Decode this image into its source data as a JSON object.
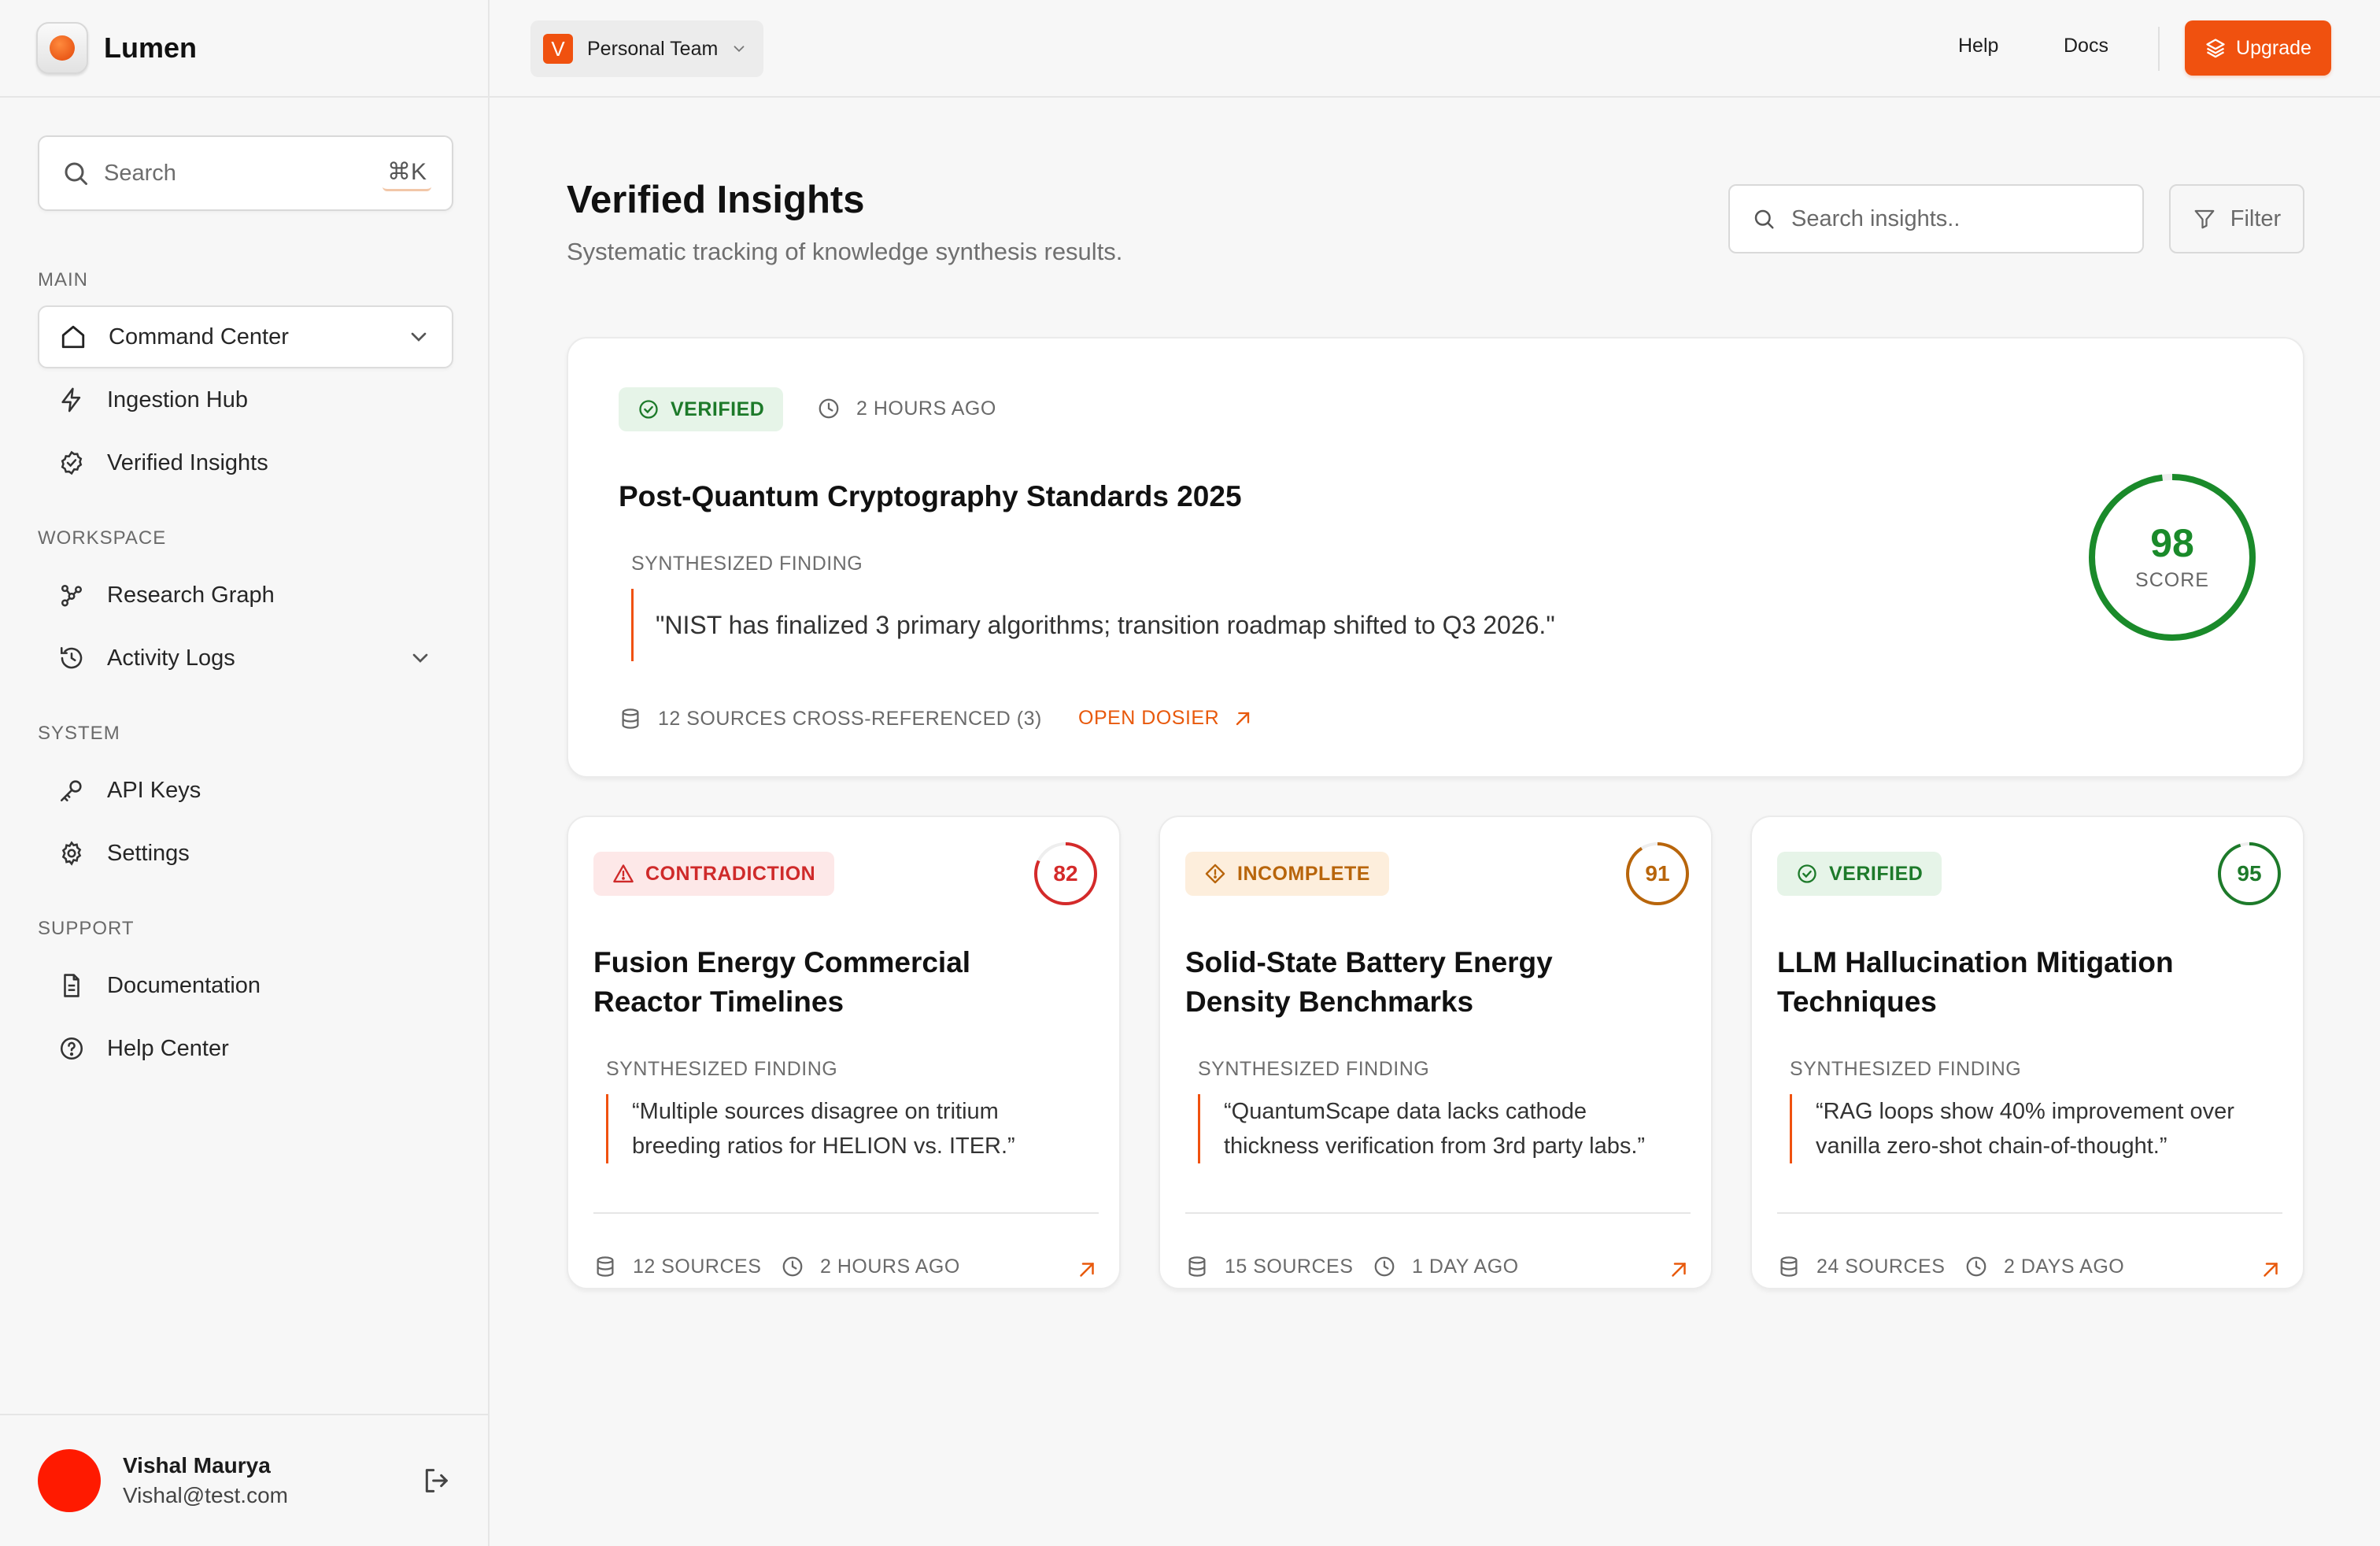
{
  "brand": {
    "name": "Lumen"
  },
  "sidebar": {
    "search": {
      "placeholder": "Search",
      "shortcut": "⌘K"
    },
    "sections": [
      {
        "title": "MAIN",
        "items": [
          {
            "label": "Command Center",
            "icon": "home-icon",
            "active": true
          },
          {
            "label": "Ingestion Hub",
            "icon": "bolt-icon"
          },
          {
            "label": "Verified Insights",
            "icon": "check-badge-icon"
          }
        ]
      },
      {
        "title": "WORKSPACE",
        "items": [
          {
            "label": "Research Graph",
            "icon": "graph-icon"
          },
          {
            "label": "Activity Logs",
            "icon": "history-icon"
          }
        ]
      },
      {
        "title": "SYSTEM",
        "items": [
          {
            "label": "API Keys",
            "icon": "key-icon"
          },
          {
            "label": "Settings",
            "icon": "gear-icon"
          }
        ]
      },
      {
        "title": "SUPPORT",
        "items": [
          {
            "label": "Documentation",
            "icon": "document-icon"
          },
          {
            "label": "Help Center",
            "icon": "help-circle-icon"
          }
        ]
      }
    ],
    "user": {
      "name": "Vishal Maurya",
      "email": "Vishal@test.com"
    }
  },
  "topbar": {
    "team": {
      "initial": "V",
      "name": "Personal Team"
    },
    "help": "Help",
    "docs": "Docs",
    "upgrade": "Upgrade"
  },
  "page": {
    "title": "Verified Insights",
    "subtitle": "Systematic tracking of knowledge synthesis results.",
    "search_placeholder": "Search insights..",
    "filter_label": "Filter"
  },
  "featured": {
    "status": "VERIFIED",
    "time": "2 HOURS AGO",
    "title": "Post-Quantum Cryptography Standards 2025",
    "finding_label": "SYNTHESIZED FINDING",
    "finding": "\"NIST has finalized 3 primary algorithms; transition roadmap shifted to Q3 2026.\"",
    "sources": "12 SOURCES CROSS-REFERENCED (3)",
    "open_label": "OPEN DOSIER",
    "score": 98,
    "score_label": "SCORE",
    "score_color": "#1a8a2a"
  },
  "cards": [
    {
      "status": "CONTRADICTION",
      "status_type": "contradiction",
      "score": 82,
      "score_color": "#d42a2a",
      "title_line1": "Fusion Energy Commercial",
      "title_line2": "Reactor Timelines",
      "finding_label": "SYNTHESIZED FINDING",
      "finding_line1": "“Multiple sources disagree on tritium",
      "finding_line2": "breeding ratios for HELION vs. ITER.”",
      "sources": "12 SOURCES",
      "time": "2 HOURS AGO"
    },
    {
      "status": "INCOMPLETE",
      "status_type": "incomplete",
      "score": 91,
      "score_color": "#b8650b",
      "title_line1": "Solid-State Battery Energy",
      "title_line2": "Density Benchmarks",
      "finding_label": "SYNTHESIZED FINDING",
      "finding_line1": "“QuantumScape data lacks cathode",
      "finding_line2": "thickness verification from 3rd party labs.”",
      "sources": "15 SOURCES",
      "time": "1 DAY AGO"
    },
    {
      "status": "VERIFIED",
      "status_type": "verified",
      "score": 95,
      "score_color": "#1d7a2a",
      "title_line1": "LLM Hallucination Mitigation",
      "title_line2": "Techniques",
      "finding_label": "SYNTHESIZED FINDING",
      "finding_line1": "“RAG loops show 40% improvement over",
      "finding_line2": "vanilla zero-shot chain-of-thought.”",
      "sources": "24 SOURCES",
      "time": "2 DAYS AGO"
    }
  ]
}
